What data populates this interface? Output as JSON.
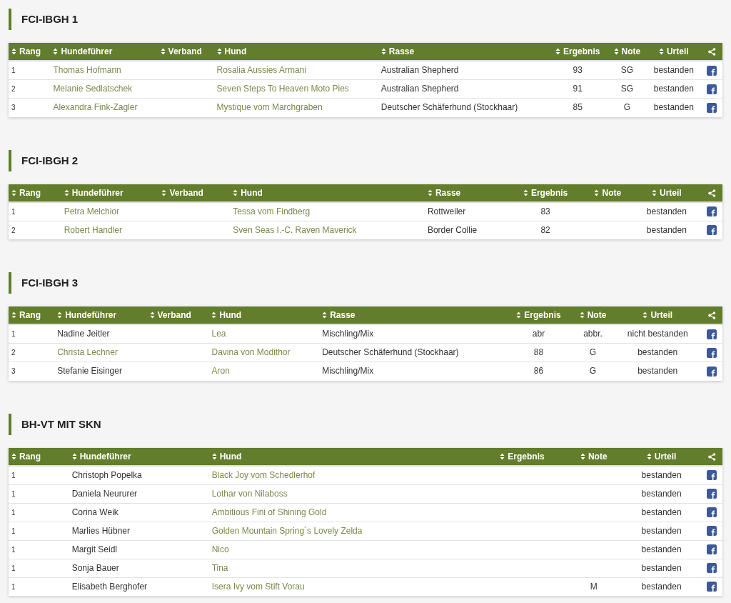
{
  "sections": [
    {
      "title": "FCI-IBGH 1",
      "columns": [
        {
          "kind": "rank",
          "label": "Rang"
        },
        {
          "kind": "handler",
          "label": "Hundeführer"
        },
        {
          "kind": "club",
          "label": "Verband"
        },
        {
          "kind": "dog",
          "label": "Hund"
        },
        {
          "kind": "breed",
          "label": "Rasse"
        },
        {
          "kind": "result",
          "label": "Ergebnis"
        },
        {
          "kind": "grade",
          "label": "Note"
        },
        {
          "kind": "verdict",
          "label": "Urteil"
        },
        {
          "kind": "share"
        }
      ],
      "rows": [
        {
          "rank": "1",
          "handler": "Thomas Hofmann",
          "handler_linked": true,
          "dog": "Rosalia Aussies Armani",
          "breed": "Australian Shepherd",
          "result": "93",
          "grade": "SG",
          "verdict": "bestanden"
        },
        {
          "rank": "2",
          "handler": "Melanie Sedlatschek",
          "handler_linked": true,
          "dog": "Seven Steps To Heaven Moto Pies",
          "breed": "Australian Shepherd",
          "result": "91",
          "grade": "SG",
          "verdict": "bestanden"
        },
        {
          "rank": "3",
          "handler": "Alexandra Fink-Zagler",
          "handler_linked": true,
          "dog": "Mystique vom Marchgraben",
          "breed": "Deutscher Schäferhund (Stockhaar)",
          "result": "85",
          "grade": "G",
          "verdict": "bestanden"
        }
      ]
    },
    {
      "title": "FCI-IBGH 2",
      "columns": [
        {
          "kind": "rank",
          "label": "Rang"
        },
        {
          "kind": "handler",
          "label": "Hundeführer"
        },
        {
          "kind": "club",
          "label": "Verband"
        },
        {
          "kind": "dog",
          "label": "Hund"
        },
        {
          "kind": "breed",
          "label": "Rasse"
        },
        {
          "kind": "result",
          "label": "Ergebnis"
        },
        {
          "kind": "grade",
          "label": "Note"
        },
        {
          "kind": "verdict",
          "label": "Urteil"
        },
        {
          "kind": "share"
        }
      ],
      "rows": [
        {
          "rank": "1",
          "handler": "Petra Melchior",
          "handler_linked": true,
          "dog": "Tessa vom Findberg",
          "breed": "Rottweiler",
          "result": "83",
          "verdict": "bestanden"
        },
        {
          "rank": "2",
          "handler": "Robert Handler",
          "handler_linked": true,
          "dog": "Sven Seas I.-C. Raven Maverick",
          "breed": "Border Collie",
          "result": "82",
          "verdict": "bestanden"
        }
      ]
    },
    {
      "title": "FCI-IBGH 3",
      "columns": [
        {
          "kind": "rank",
          "label": "Rang"
        },
        {
          "kind": "handler",
          "label": "Hundeführer"
        },
        {
          "kind": "club",
          "label": "Verband"
        },
        {
          "kind": "dog",
          "label": "Hund"
        },
        {
          "kind": "breed",
          "label": "Rasse"
        },
        {
          "kind": "result",
          "label": "Ergebnis"
        },
        {
          "kind": "grade",
          "label": "Note"
        },
        {
          "kind": "verdict",
          "label": "Urteil"
        },
        {
          "kind": "share"
        }
      ],
      "rows": [
        {
          "rank": "1",
          "handler": "Nadine Jeitler",
          "handler_linked": false,
          "dog": "Lea",
          "breed": "Mischling/Mix",
          "result": "abr",
          "grade": "abbr.",
          "verdict": "nicht bestanden"
        },
        {
          "rank": "2",
          "handler": "Christa Lechner",
          "handler_linked": true,
          "dog": "Davina von Modithor",
          "breed": "Deutscher Schäferhund (Stockhaar)",
          "result": "88",
          "grade": "G",
          "verdict": "bestanden"
        },
        {
          "rank": "3",
          "handler": "Stefanie Eisinger",
          "handler_linked": false,
          "dog": "Aron",
          "breed": "Mischling/Mix",
          "result": "86",
          "grade": "G",
          "verdict": "bestanden"
        }
      ]
    },
    {
      "title": "BH-VT MIT SKN",
      "columns": [
        {
          "kind": "rank",
          "label": "Rang"
        },
        {
          "kind": "handler",
          "label": "Hundeführer"
        },
        {
          "kind": "dog",
          "label": "Hund"
        },
        {
          "kind": "result",
          "label": "Ergebnis"
        },
        {
          "kind": "grade",
          "label": "Note"
        },
        {
          "kind": "verdict",
          "label": "Urteil"
        },
        {
          "kind": "share"
        }
      ],
      "rows": [
        {
          "rank": "1",
          "handler": "Christoph Popelka",
          "handler_linked": false,
          "dog": "Black Joy vom Schedlerhof",
          "verdict": "bestanden"
        },
        {
          "rank": "1",
          "handler": "Daniela Neururer",
          "handler_linked": false,
          "dog": "Lothar von Nilaboss",
          "verdict": "bestanden"
        },
        {
          "rank": "1",
          "handler": "Corina Weik",
          "handler_linked": false,
          "dog": "Ambitious Fini of Shining Gold",
          "verdict": "bestanden"
        },
        {
          "rank": "1",
          "handler": "Marlies Hübner",
          "handler_linked": false,
          "dog": "Golden Mountain Spring´s Lovely Zelda",
          "verdict": "bestanden"
        },
        {
          "rank": "1",
          "handler": "Margit Seidl",
          "handler_linked": false,
          "dog": "Nico",
          "verdict": "bestanden"
        },
        {
          "rank": "1",
          "handler": "Sonja Bauer",
          "handler_linked": false,
          "dog": "Tina",
          "verdict": "bestanden"
        },
        {
          "rank": "1",
          "handler": "Elisabeth Berghofer",
          "handler_linked": false,
          "dog": "Isera Ivy vom Stift Vorau",
          "grade": "M",
          "verdict": "bestanden"
        }
      ]
    }
  ]
}
